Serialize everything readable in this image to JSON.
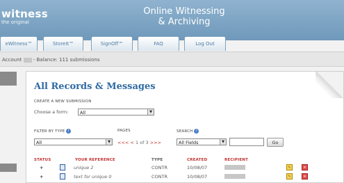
{
  "header": {
    "logo": "witness",
    "logo_tag": "the original",
    "tagline_1": "Online Witnessing",
    "tagline_2": "& Archiving"
  },
  "nav": {
    "tabs": [
      {
        "label": "eWitness™"
      },
      {
        "label": "StoreIt™"
      },
      {
        "label": "SignOff™"
      },
      {
        "label": "FAQ"
      },
      {
        "label": "Log Out"
      }
    ]
  },
  "account": {
    "prefix": "Account",
    "balance_text": "- Balance: 111 submissions"
  },
  "main": {
    "title": "All Records & Messages",
    "create_label": "CREATE A NEW SUBMISSION",
    "choose_label": "Choose a form:",
    "form_select_value": "All",
    "filter_label": "FILTER BY TYPE",
    "filter_select_value": "All",
    "pages_label": "PAGES",
    "pager_prev": "<<< <",
    "pager_pages": "1 of 3",
    "pager_next": ">>>",
    "search_label": "SEARCH",
    "search_field_value": "All Fields",
    "go_label": "Go"
  },
  "table": {
    "headers": {
      "status": "STATUS",
      "your_reference": "YOUR REFERENCE",
      "type": "TYPE",
      "created": "CREATED",
      "recipient": "RECIPIENT"
    },
    "rows": [
      {
        "expand": "+",
        "reference": "unique 2",
        "type": "CONTR",
        "created": "10/08/07"
      },
      {
        "expand": "+",
        "reference": "text for unique 0",
        "type": "CONTR",
        "created": "10/08/07"
      }
    ]
  },
  "colors": {
    "header_blue": "#7aa2c3",
    "title_blue": "#2e6aa3",
    "accent_red": "#c03030"
  }
}
